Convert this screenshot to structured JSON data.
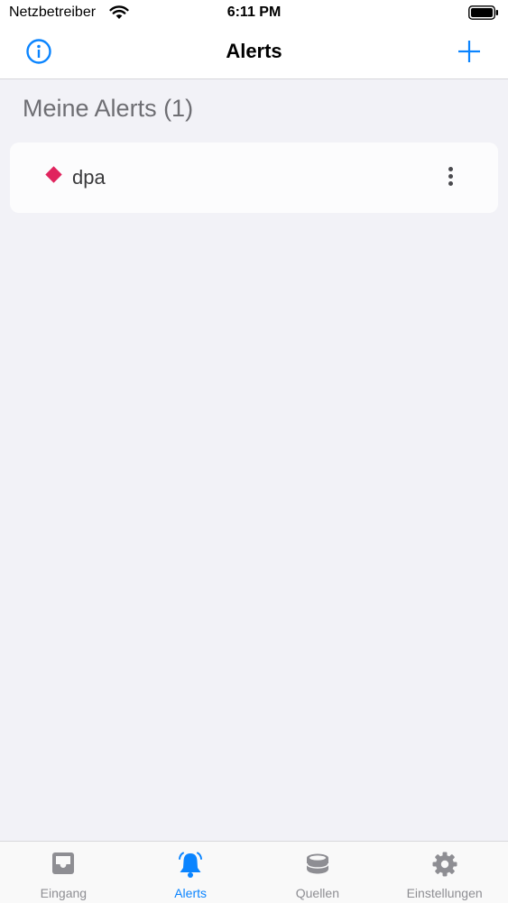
{
  "status_bar": {
    "carrier": "Netzbetreiber",
    "time": "6:11 PM"
  },
  "nav": {
    "title": "Alerts",
    "left_icon": "info-icon",
    "right_icon": "plus-icon",
    "accent_color": "#0a84ff"
  },
  "section": {
    "title": "Meine Alerts (1)"
  },
  "alerts": [
    {
      "name": "dpa",
      "color": "#e0245e"
    }
  ],
  "tabs": [
    {
      "label": "Eingang",
      "icon": "inbox-icon",
      "active": false
    },
    {
      "label": "Alerts",
      "icon": "bell-icon",
      "active": true
    },
    {
      "label": "Quellen",
      "icon": "database-icon",
      "active": false
    },
    {
      "label": "Einstellungen",
      "icon": "gear-icon",
      "active": false
    }
  ]
}
